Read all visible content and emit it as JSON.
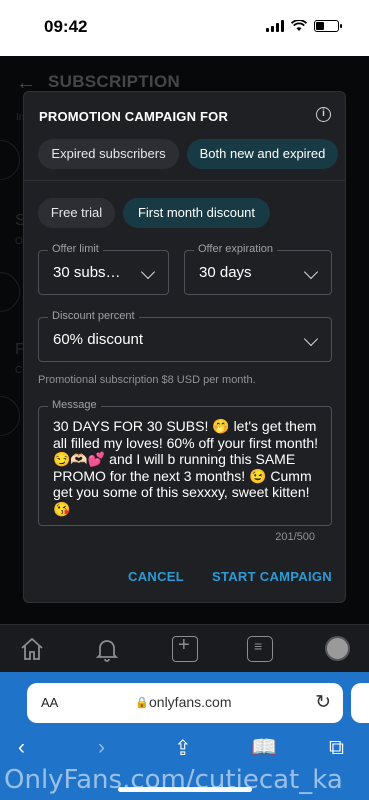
{
  "status": {
    "time": "09:42"
  },
  "app": {
    "title": "SUBSCRIPTION",
    "background_fragments": [
      "S",
      "F",
      "O",
      "C",
      "In"
    ]
  },
  "modal": {
    "title": "PROMOTION CAMPAIGN FOR",
    "audience_options": [
      "Expired subscribers",
      "Both new and expired"
    ],
    "audience_selected": "Both new and expired",
    "type_options": [
      "Free trial",
      "First month discount"
    ],
    "type_selected": "First month discount",
    "offer_limit": {
      "label": "Offer limit",
      "value": "30 subs…"
    },
    "offer_expiration": {
      "label": "Offer expiration",
      "value": "30 days"
    },
    "discount_percent": {
      "label": "Discount percent",
      "value": "60% discount"
    },
    "helper_text": "Promotional subscription $8 USD per month.",
    "message": {
      "label": "Message",
      "text": "30 DAYS FOR 30 SUBS! 🤭 let's get them all filled my loves! 60% off your first month! 😏🫶🏻💕 and I will b running this SAME PROMO for the next 3 months! 😉 Cumm get you some of this sexxxy, sweet kitten! 😘",
      "counter": "201/500"
    },
    "cancel_label": "CANCEL",
    "start_label": "START CAMPAIGN"
  },
  "browser": {
    "aa_label": "AA",
    "url": "onlyfans.com"
  },
  "watermark": "OnlyFans.com/cutiecat_ka",
  "colors": {
    "accent": "#2b9bd6",
    "chip_active": "#173a45",
    "safari_bar": "#1f73c9"
  }
}
